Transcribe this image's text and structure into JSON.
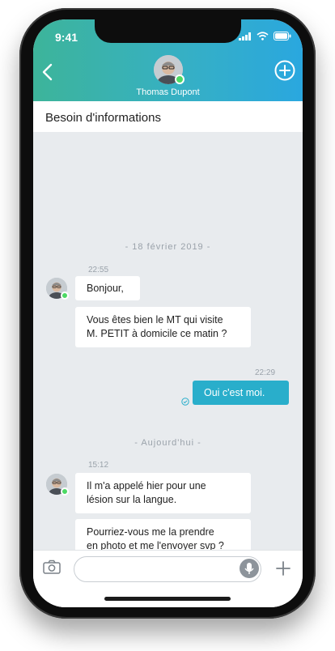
{
  "status_bar": {
    "time": "9:41"
  },
  "header": {
    "contact_name": "Thomas Dupont"
  },
  "subject": {
    "title": "Besoin d'informations"
  },
  "chat": {
    "date1": "- 18 février 2019 -",
    "group1": {
      "time": "22:55",
      "messages": [
        "Bonjour,",
        "Vous êtes bien le MT qui visite\nM. PETIT à domicile ce matin ?"
      ]
    },
    "outgoing": {
      "time": "22:29",
      "text": "Oui c'est moi."
    },
    "date2": "- Aujourd'hui -",
    "group2": {
      "time": "15:12",
      "messages": [
        "Il m'a appelé hier pour une\nlésion sur la langue.",
        "Pourriez-vous me la prendre\nen photo et me l'envoyer svp ?"
      ]
    }
  },
  "icons": {
    "back": "chevron-left-icon",
    "add_conversation": "plus-circle-icon",
    "camera": "camera-icon",
    "microphone": "microphone-icon",
    "add_attachment": "plus-icon",
    "read_receipt": "check-circle-icon"
  },
  "colors": {
    "header_start": "#3db49a",
    "header_end": "#2aa7df",
    "outgoing_bubble": "#29aecb",
    "online": "#4cd964"
  }
}
